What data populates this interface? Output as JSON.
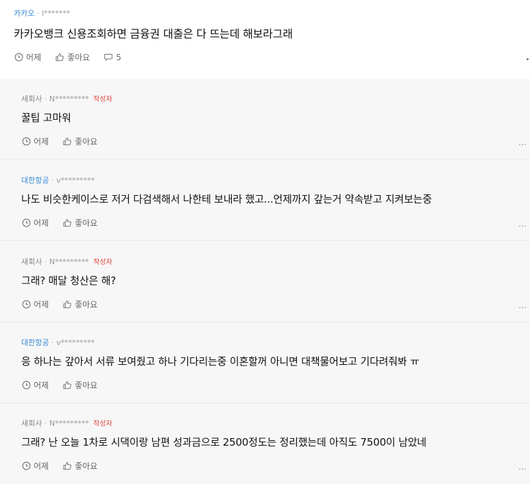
{
  "post": {
    "company": "카카오",
    "separator": "·",
    "author": "l*******",
    "text": "카카오뱅크 신용조회하면 금융권 대출은 다 뜨는데 해보라그래",
    "time": "어제",
    "like_label": "좋아요",
    "comment_count": "5"
  },
  "comments": [
    {
      "company": "새회사",
      "author": "N*********",
      "badge": "작성자",
      "text": "꿀팁 고마워",
      "time": "어제",
      "like_label": "좋아요",
      "more": "…"
    },
    {
      "company": "대한항공",
      "author": "v*********",
      "badge": "",
      "text": "나도 비슷한케이스로 저거 다검색해서 나한테 보내라 했고...언제까지 갚는거 약속받고 지켜보는중",
      "time": "어제",
      "like_label": "좋아요",
      "more": "…"
    },
    {
      "company": "새회사",
      "author": "N*********",
      "badge": "작성자",
      "text": "그래? 매달 청산은 해?",
      "time": "어제",
      "like_label": "좋아요",
      "more": "…"
    },
    {
      "company": "대한항공",
      "author": "v*********",
      "badge": "",
      "text": "응 하나는 갚아서 서류 보여줬고 하나 기다리는중 이혼할꺼 아니면 대책물어보고 기다려줘봐 ㅠ",
      "time": "어제",
      "like_label": "좋아요",
      "more": ""
    },
    {
      "company": "새회사",
      "author": "N*********",
      "badge": "작성자",
      "text": "그래? 난 오늘 1차로 시댁이랑 남편 성과금으로 2500정도는 정리했는데 아직도 7500이 남았네",
      "time": "어제",
      "like_label": "좋아요",
      "more": "…"
    }
  ],
  "colors": {
    "company_link": "#3a8ad6",
    "author_badge": "#e0453b",
    "comment_bg": "#f7f7f7"
  },
  "icons": {
    "time": "clock-icon",
    "like": "thumbs-up-icon",
    "comment": "speech-bubble-icon",
    "more": "more-dots-icon"
  }
}
